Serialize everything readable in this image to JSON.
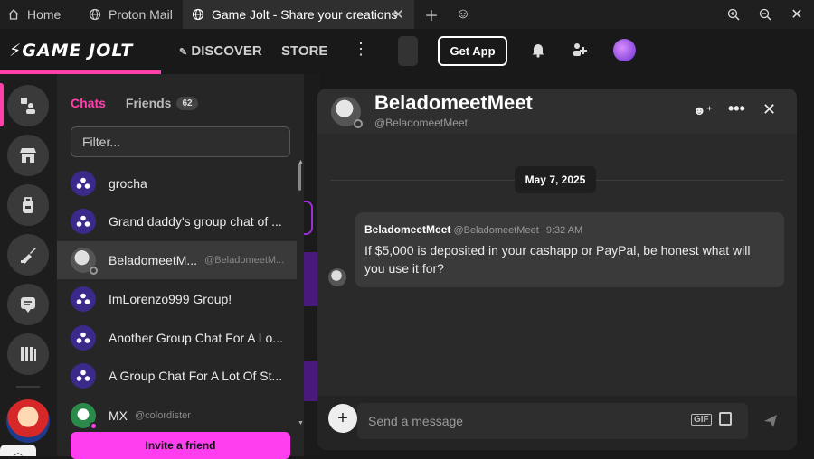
{
  "browser": {
    "home_tab": "Home",
    "proton_tab": "Proton Mail",
    "active_tab": "Game Jolt - Share your creations"
  },
  "header": {
    "logo": "GAME JOLT",
    "discover": "DISCOVER",
    "store": "STORE",
    "get_app": "Get App"
  },
  "chat_panel": {
    "tab_chats": "Chats",
    "tab_friends": "Friends",
    "friends_count": "62",
    "filter_placeholder": "Filter...",
    "items": [
      {
        "name": "grocha",
        "handle": ""
      },
      {
        "name": "Grand daddy's group chat of ...",
        "handle": ""
      },
      {
        "name": "BeladomeetM...",
        "handle": "@BeladomeetM..."
      },
      {
        "name": "ImLorenzo999 Group!",
        "handle": ""
      },
      {
        "name": "Another Group Chat For A Lo...",
        "handle": ""
      },
      {
        "name": "A Group Chat For A Lot Of St...",
        "handle": ""
      },
      {
        "name": "MX",
        "handle": "@colordister"
      }
    ],
    "invite": "Invite a friend"
  },
  "chat_window": {
    "name": "BeladomeetMeet",
    "handle": "@BeladomeetMeet",
    "date": "May 7, 2025",
    "message": {
      "author": "BeladomeetMeet",
      "handle": "@BeladomeetMeet",
      "time": "9:32 AM",
      "text": "If $5,000 is deposited in your cashapp or PayPal, be honest what will you use it for?"
    },
    "input_placeholder": "Send a message",
    "gif_label": "GIF"
  },
  "colors": {
    "accent": "#ff3fac",
    "invite": "#ff3fef",
    "group_avatar": "#3b2a8a"
  }
}
